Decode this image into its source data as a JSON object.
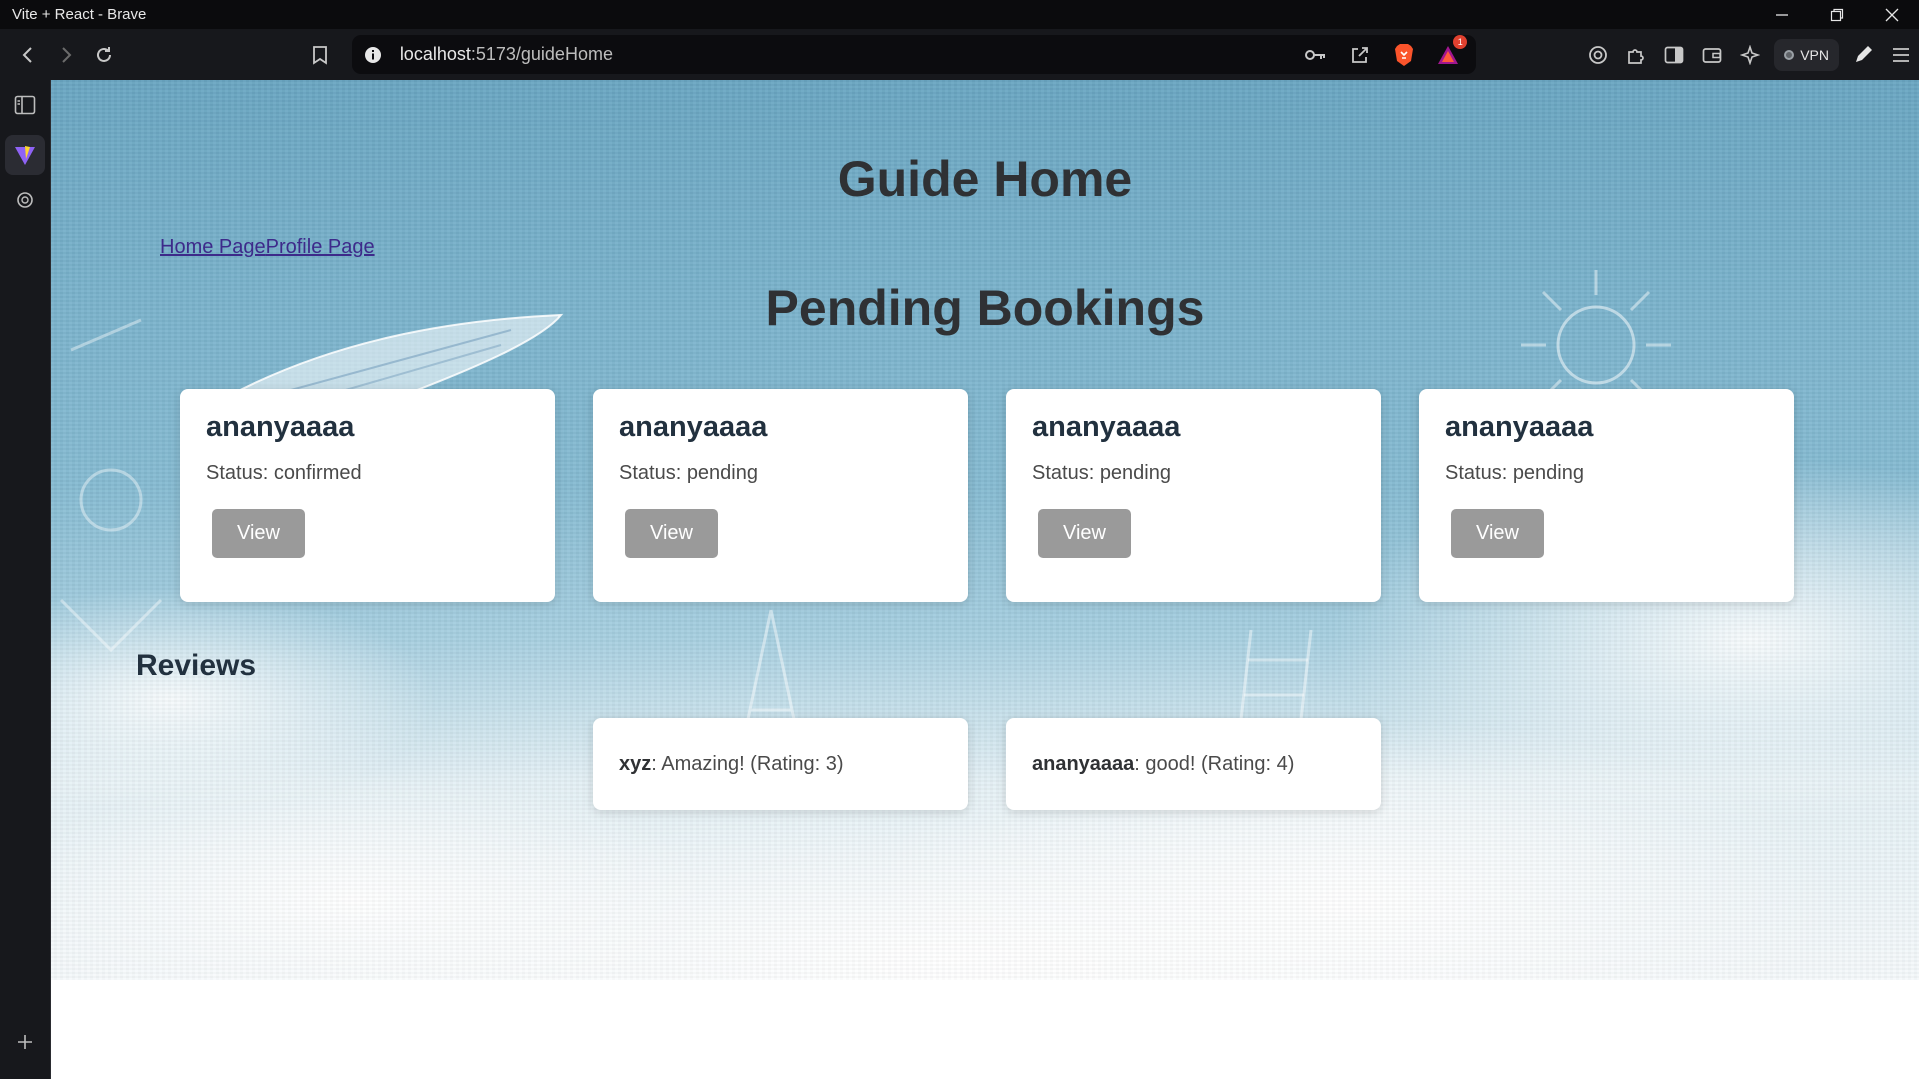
{
  "window": {
    "title": "Vite + React - Brave"
  },
  "browser": {
    "url_host": "localhost",
    "url_rest": ":5173/guideHome",
    "vpn_label": "VPN",
    "notification_count": "1"
  },
  "page": {
    "title": "Guide Home",
    "nav_links": [
      "Home Page",
      "Profile Page"
    ],
    "bookings_title": "Pending Bookings",
    "bookings": [
      {
        "name": "ananyaaaa",
        "status": "Status: confirmed",
        "button": "View"
      },
      {
        "name": "ananyaaaa",
        "status": "Status: pending",
        "button": "View"
      },
      {
        "name": "ananyaaaa",
        "status": "Status: pending",
        "button": "View"
      },
      {
        "name": "ananyaaaa",
        "status": "Status: pending",
        "button": "View"
      }
    ],
    "reviews_title": "Reviews",
    "reviews": [
      {
        "author": "xyz",
        "text": ": Amazing! (Rating: 3)"
      },
      {
        "author": "ananyaaaa",
        "text": ": good! (Rating: 4)"
      }
    ]
  },
  "colors": {
    "card_button": "#9a9a9a",
    "heading": "#2f3134",
    "link": "#3d2a8a"
  }
}
